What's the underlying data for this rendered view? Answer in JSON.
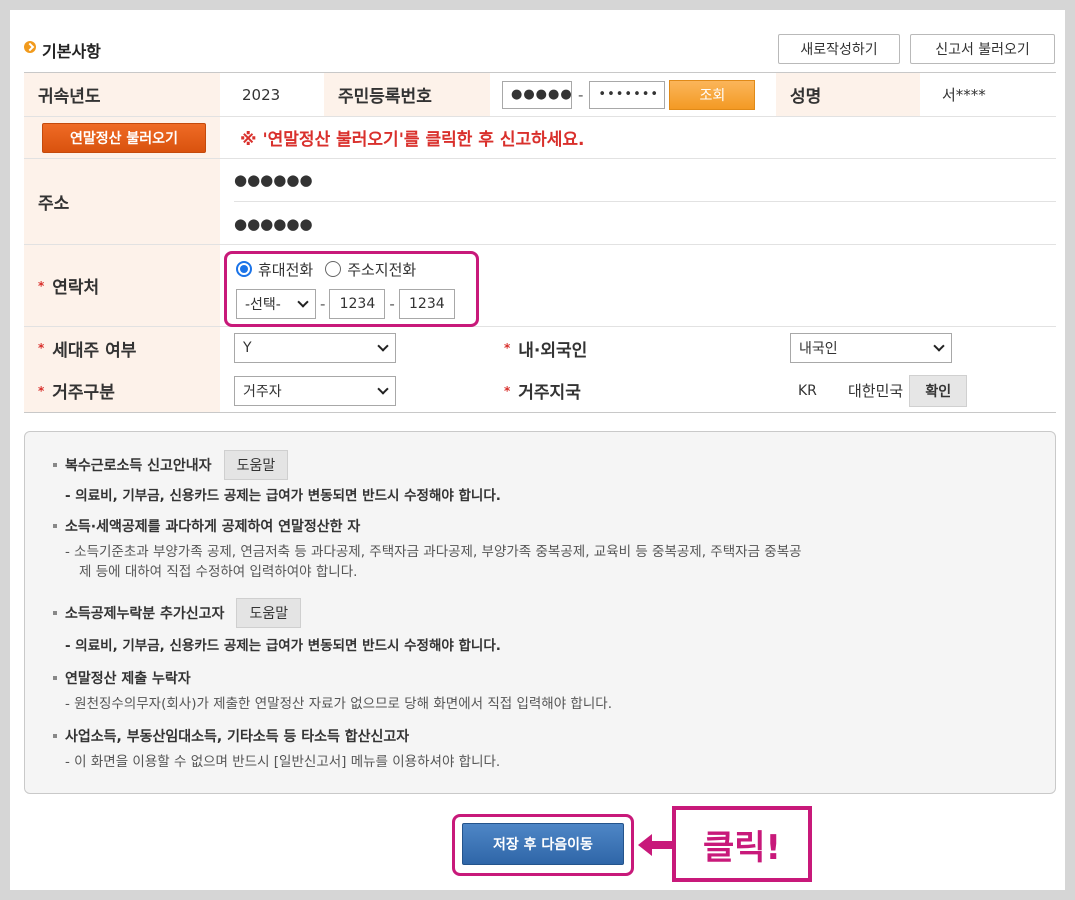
{
  "section": {
    "title": "기본사항",
    "buttons": {
      "new_write": "새로작성하기",
      "load_report": "신고서 불러오기"
    }
  },
  "form": {
    "year_label": "귀속년도",
    "year_value": "2023",
    "ssn_label": "주민등록번호",
    "ssn_first": "●●●●●",
    "ssn_second": "•••••••",
    "ssn_dash": "-",
    "lookup_button": "조회",
    "name_label": "성명",
    "name_value": "서****",
    "year_end_button": "연말정산 불러오기",
    "warning": "※ '연말정산 불러오기'를 클릭한 후 신고하세요.",
    "address_label": "주소",
    "address_line1": "●●●●●●",
    "address_line2": "●●●●●●",
    "contact_label": "연락처",
    "radio_mobile": "휴대전화",
    "radio_home": "주소지전화",
    "phone_select": "-선택-",
    "phone_mid": "1234",
    "phone_last": "1234",
    "householder_label": "세대주 여부",
    "householder_value": "Y",
    "nationality_label": "내·외국인",
    "nationality_value": "내국인",
    "residence_label": "거주구분",
    "residence_value": "거주자",
    "residence_country_label": "거주지국",
    "country_code": "KR",
    "country_name": "대한민국",
    "confirm_button": "확인",
    "required_mark": "*"
  },
  "notice": {
    "item1_title": "복수근로소득 신고안내자",
    "item1_help": "도움말",
    "item1_desc": "- 의료비, 기부금, 신용카드 공제는 급여가 변동되면 반드시 수정해야 합니다.",
    "item2_title": "소득·세액공제를 과다하게 공제하여 연말정산한 자",
    "item2_desc_line1": "- 소득기준초과 부양가족 공제, 연금저축 등 과다공제, 주택자금 과다공제, 부양가족 중복공제, 교육비 등 중복공제, 주택자금 중복공",
    "item2_desc_line2": "제 등에 대하여 직접 수정하여 입력하여야 합니다.",
    "item3_title": "소득공제누락분 추가신고자",
    "item3_help": "도움말",
    "item3_desc": "- 의료비, 기부금, 신용카드 공제는 급여가 변동되면 반드시 수정해야 합니다.",
    "item4_title": "연말정산 제출 누락자",
    "item4_desc": "- 원천징수의무자(회사)가 제출한 연말정산 자료가 없으므로 당해 화면에서 직접 입력해야 합니다.",
    "item5_title": "사업소득, 부동산임대소득, 기타소득 등 타소득 합산신고자",
    "item5_desc": "- 이 화면을 이용할 수 없으며 반드시 [일반신고서] 메뉴를 이용하셔야 합니다."
  },
  "footer": {
    "save_next_button": "저장 후 다음이동",
    "callout": "클릭!"
  },
  "colors": {
    "highlight": "#c8197a",
    "accent_orange": "#f39a24",
    "primary_blue": "#2f66a8",
    "warning_red": "#d9302c"
  }
}
